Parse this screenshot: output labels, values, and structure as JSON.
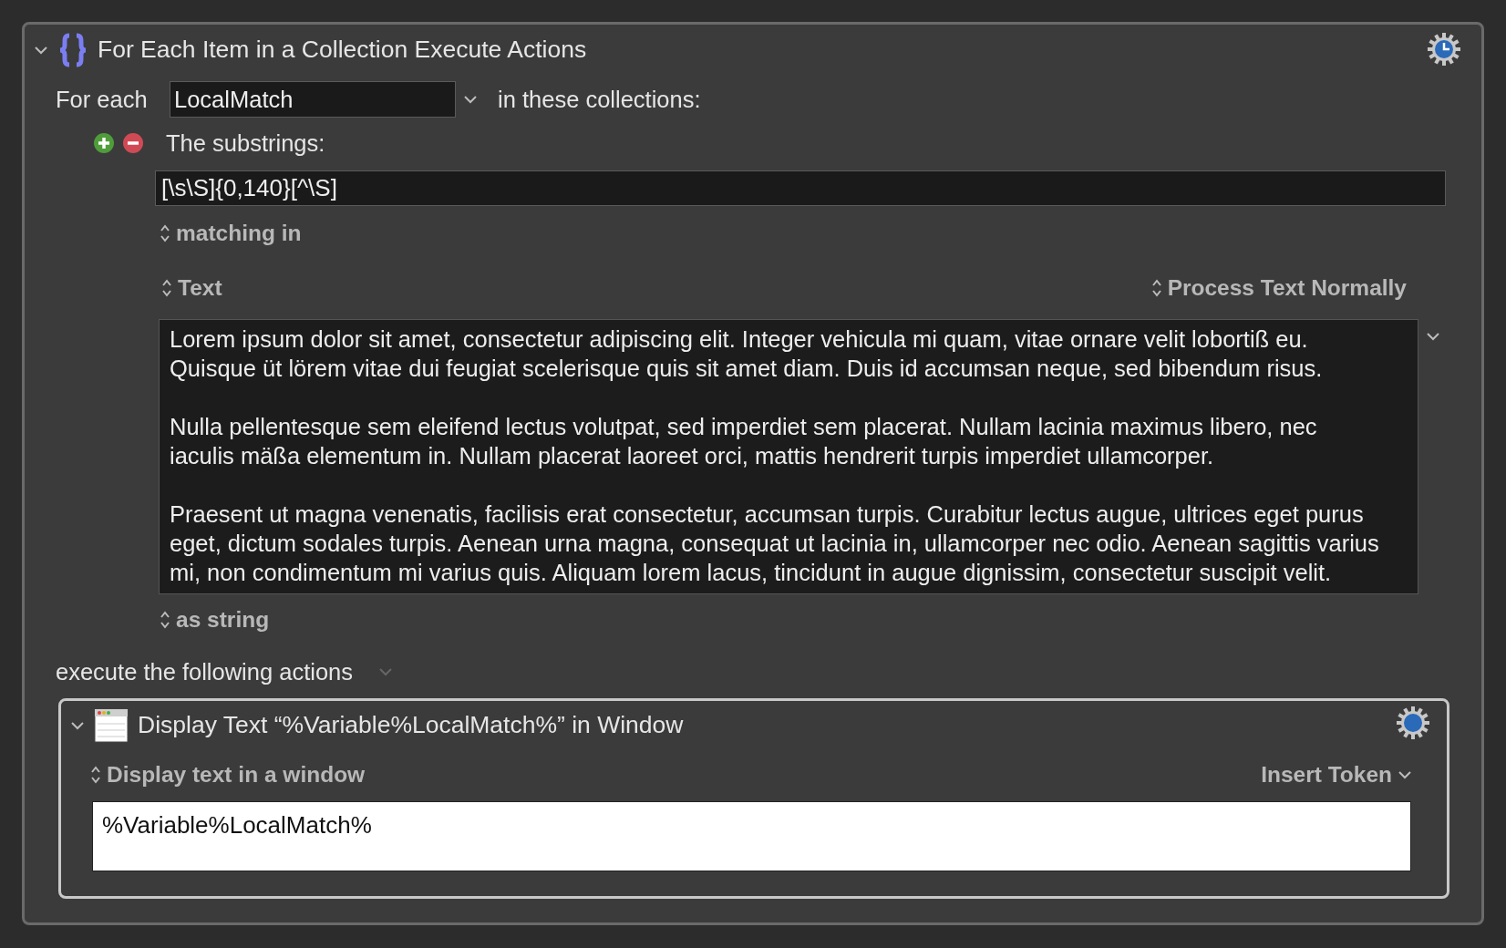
{
  "action": {
    "title": "For Each Item in a Collection Execute Actions",
    "expanded": true,
    "for_each_label": "For each",
    "variable": "LocalMatch",
    "collections_label": "in these collections:",
    "collection": {
      "title": "The substrings:",
      "regex": "[\\s\\S]{0,140}[^\\S]",
      "matching_label": "matching in",
      "source": "Text",
      "processing": "Process Text Normally",
      "paragraphs": [
        [
          "Lorem ipsum dolor sit amet, consectetur adipiscing elit. Integer vehicula mi quam, vitae ornare velit lobortiß eu.",
          "Quisque üt lörem vitae dui feugiat scelerisque quis sit amet diam. Duis id accumsan neque, sed bibendum risus."
        ],
        [
          "Nulla pellentesque sem eleifend lectus volutpat, sed imperdiet sem placerat. Nullam lacinia maximus libero, nec",
          "iaculis mäßa elementum in. Nullam placerat laoreet orci, mattis hendrerit turpis imperdiet ullamcorper."
        ],
        [
          "Praesent ut magna venenatis, facilisis erat consectetur, accumsan turpis. Curabitur lectus augue, ultrices eget purus",
          "eget, dictum sodales turpis. Aenean urna magna, consequat ut lacinia in, ullamcorper nec odio. Aenean sagittis varius",
          "mi, non condimentum mi varius quis. Aliquam lorem lacus, tincidunt in augue dignissim, consectetur suscipit velit."
        ]
      ],
      "as_label": "as string"
    },
    "execute_label": "execute the following actions",
    "sub_actions": [
      {
        "title": "Display Text “%Variable%LocalMatch%” in Window",
        "expanded": true,
        "mode": "Display text in a window",
        "insert_token": "Insert Token",
        "text": "%Variable%LocalMatch%"
      }
    ]
  }
}
